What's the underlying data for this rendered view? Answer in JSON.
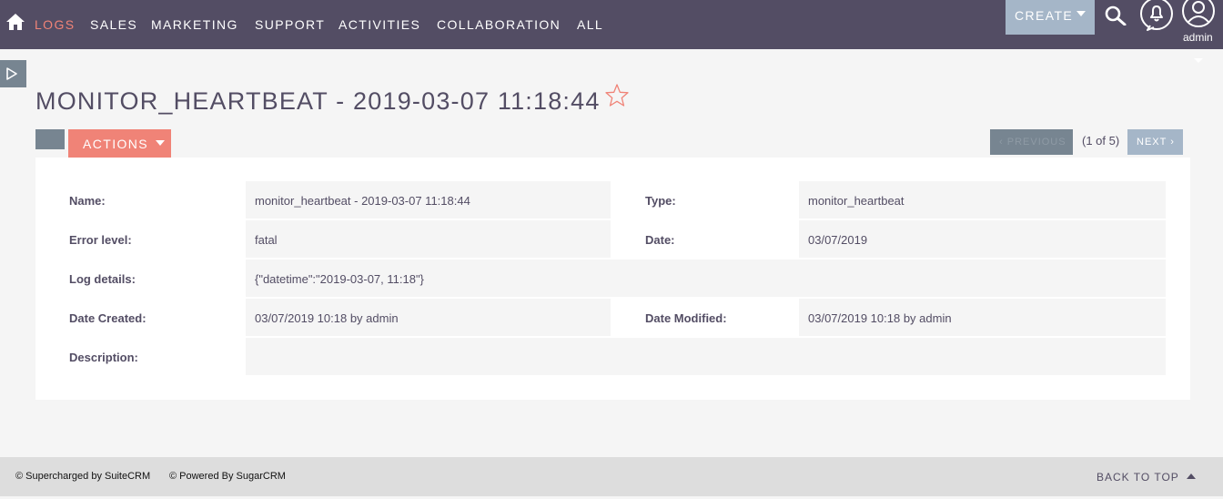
{
  "nav": {
    "items": [
      {
        "label": "LOGS"
      },
      {
        "label": "SALES"
      },
      {
        "label": "MARKETING"
      },
      {
        "label": "SUPPORT"
      },
      {
        "label": "ACTIVITIES"
      },
      {
        "label": "COLLABORATION"
      },
      {
        "label": "ALL"
      }
    ],
    "active": "LOGS",
    "create_label": "CREATE",
    "user": "admin",
    "icons": [
      "home-icon",
      "search-icon",
      "bell-icon",
      "user-icon"
    ]
  },
  "page": {
    "title": "MONITOR_HEARTBEAT - 2019-03-07 11:18:44",
    "actions_label": "ACTIONS",
    "pagination": {
      "previous_label": "PREVIOUS",
      "count": "(1 of 5)",
      "next_label": "NEXT"
    }
  },
  "detail": {
    "name": {
      "label": "Name:",
      "value": "monitor_heartbeat - 2019-03-07 11:18:44"
    },
    "type": {
      "label": "Type:",
      "value": "monitor_heartbeat"
    },
    "error_level": {
      "label": "Error level:",
      "value": "fatal"
    },
    "date": {
      "label": "Date:",
      "value": "03/07/2019"
    },
    "log_details": {
      "label": "Log details:",
      "value": "{\"datetime\":\"2019-03-07, 11:18\"}"
    },
    "date_created": {
      "label": "Date Created:",
      "value": "03/07/2019 10:18 by admin"
    },
    "date_modified": {
      "label": "Date Modified:",
      "value": "03/07/2019 10:18 by admin"
    },
    "description": {
      "label": "Description:",
      "value": ""
    }
  },
  "footer": {
    "suitecrm": "© Supercharged by SuiteCRM",
    "sugarcrm": "© Powered By SugarCRM",
    "back_to_top": "BACK TO TOP"
  },
  "colors": {
    "nav_bg": "#534d64",
    "accent": "#f08377",
    "create_bg": "#a5b6c8",
    "secondary": "#778591"
  }
}
